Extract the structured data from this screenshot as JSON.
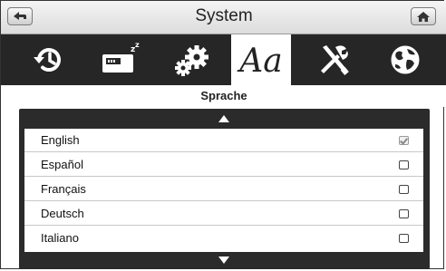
{
  "header": {
    "title": "System",
    "back_icon": "back-arrow-icon",
    "home_icon": "home-icon"
  },
  "tabs": [
    {
      "icon": "history-clock-icon",
      "active": false
    },
    {
      "icon": "battery-sleep-icon",
      "active": false
    },
    {
      "icon": "gears-icon",
      "active": false
    },
    {
      "icon": "font-aa-icon",
      "label": "Aa",
      "active": true
    },
    {
      "icon": "tools-icon",
      "active": false
    },
    {
      "icon": "globe-icon",
      "active": false
    }
  ],
  "section": {
    "title": "Sprache"
  },
  "languages": [
    {
      "label": "English",
      "checked": true
    },
    {
      "label": "Español",
      "checked": false
    },
    {
      "label": "Français",
      "checked": false
    },
    {
      "label": "Deutsch",
      "checked": false
    },
    {
      "label": "Italiano",
      "checked": false
    }
  ],
  "colors": {
    "tabbar": "#262626",
    "active_tab": "#ffffff",
    "list_frame": "#2b2b2b"
  }
}
